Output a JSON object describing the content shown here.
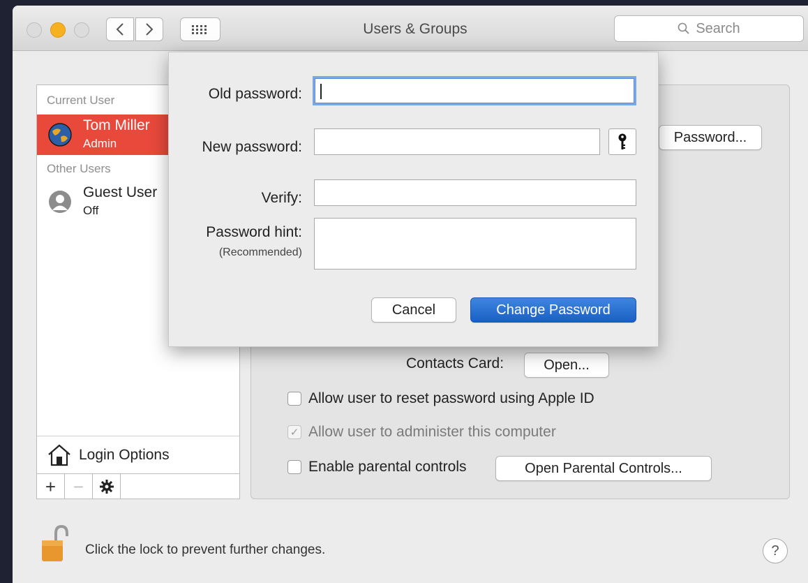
{
  "window": {
    "title": "Users & Groups",
    "search_placeholder": "Search"
  },
  "sidebar": {
    "current_user_label": "Current User",
    "other_users_label": "Other Users",
    "users": [
      {
        "name": "Tom Miller",
        "role": "Admin",
        "selected": true
      },
      {
        "name": "Guest User",
        "role": "Off",
        "selected": false
      }
    ],
    "login_options_label": "Login Options",
    "toolbar": {
      "add": "+",
      "remove": "−",
      "action": "gear-icon"
    }
  },
  "panel": {
    "change_password_button": "Password...",
    "contacts_card_label": "Contacts Card:",
    "open_button": "Open...",
    "checkboxes": [
      {
        "label": "Allow user to reset password using Apple ID",
        "checked": false,
        "enabled": true
      },
      {
        "label": "Allow user to administer this computer",
        "checked": true,
        "enabled": false
      },
      {
        "label": "Enable parental controls",
        "checked": false,
        "enabled": true
      }
    ],
    "open_parental_controls_button": "Open Parental Controls..."
  },
  "sheet": {
    "old_password_label": "Old password:",
    "old_password_value": "",
    "new_password_label": "New password:",
    "new_password_value": "",
    "verify_label": "Verify:",
    "verify_value": "",
    "hint_label": "Password hint:",
    "hint_sublabel": "(Recommended)",
    "hint_value": "",
    "cancel_button": "Cancel",
    "change_password_button": "Change Password"
  },
  "footer": {
    "lock_text": "Click the lock to prevent further changes.",
    "help_label": "?"
  },
  "colors": {
    "selection": "#e8493b",
    "primary_button": "#1a5fc4",
    "focus_ring": "#7ea6e0",
    "minimize_light": "#f5b120"
  }
}
